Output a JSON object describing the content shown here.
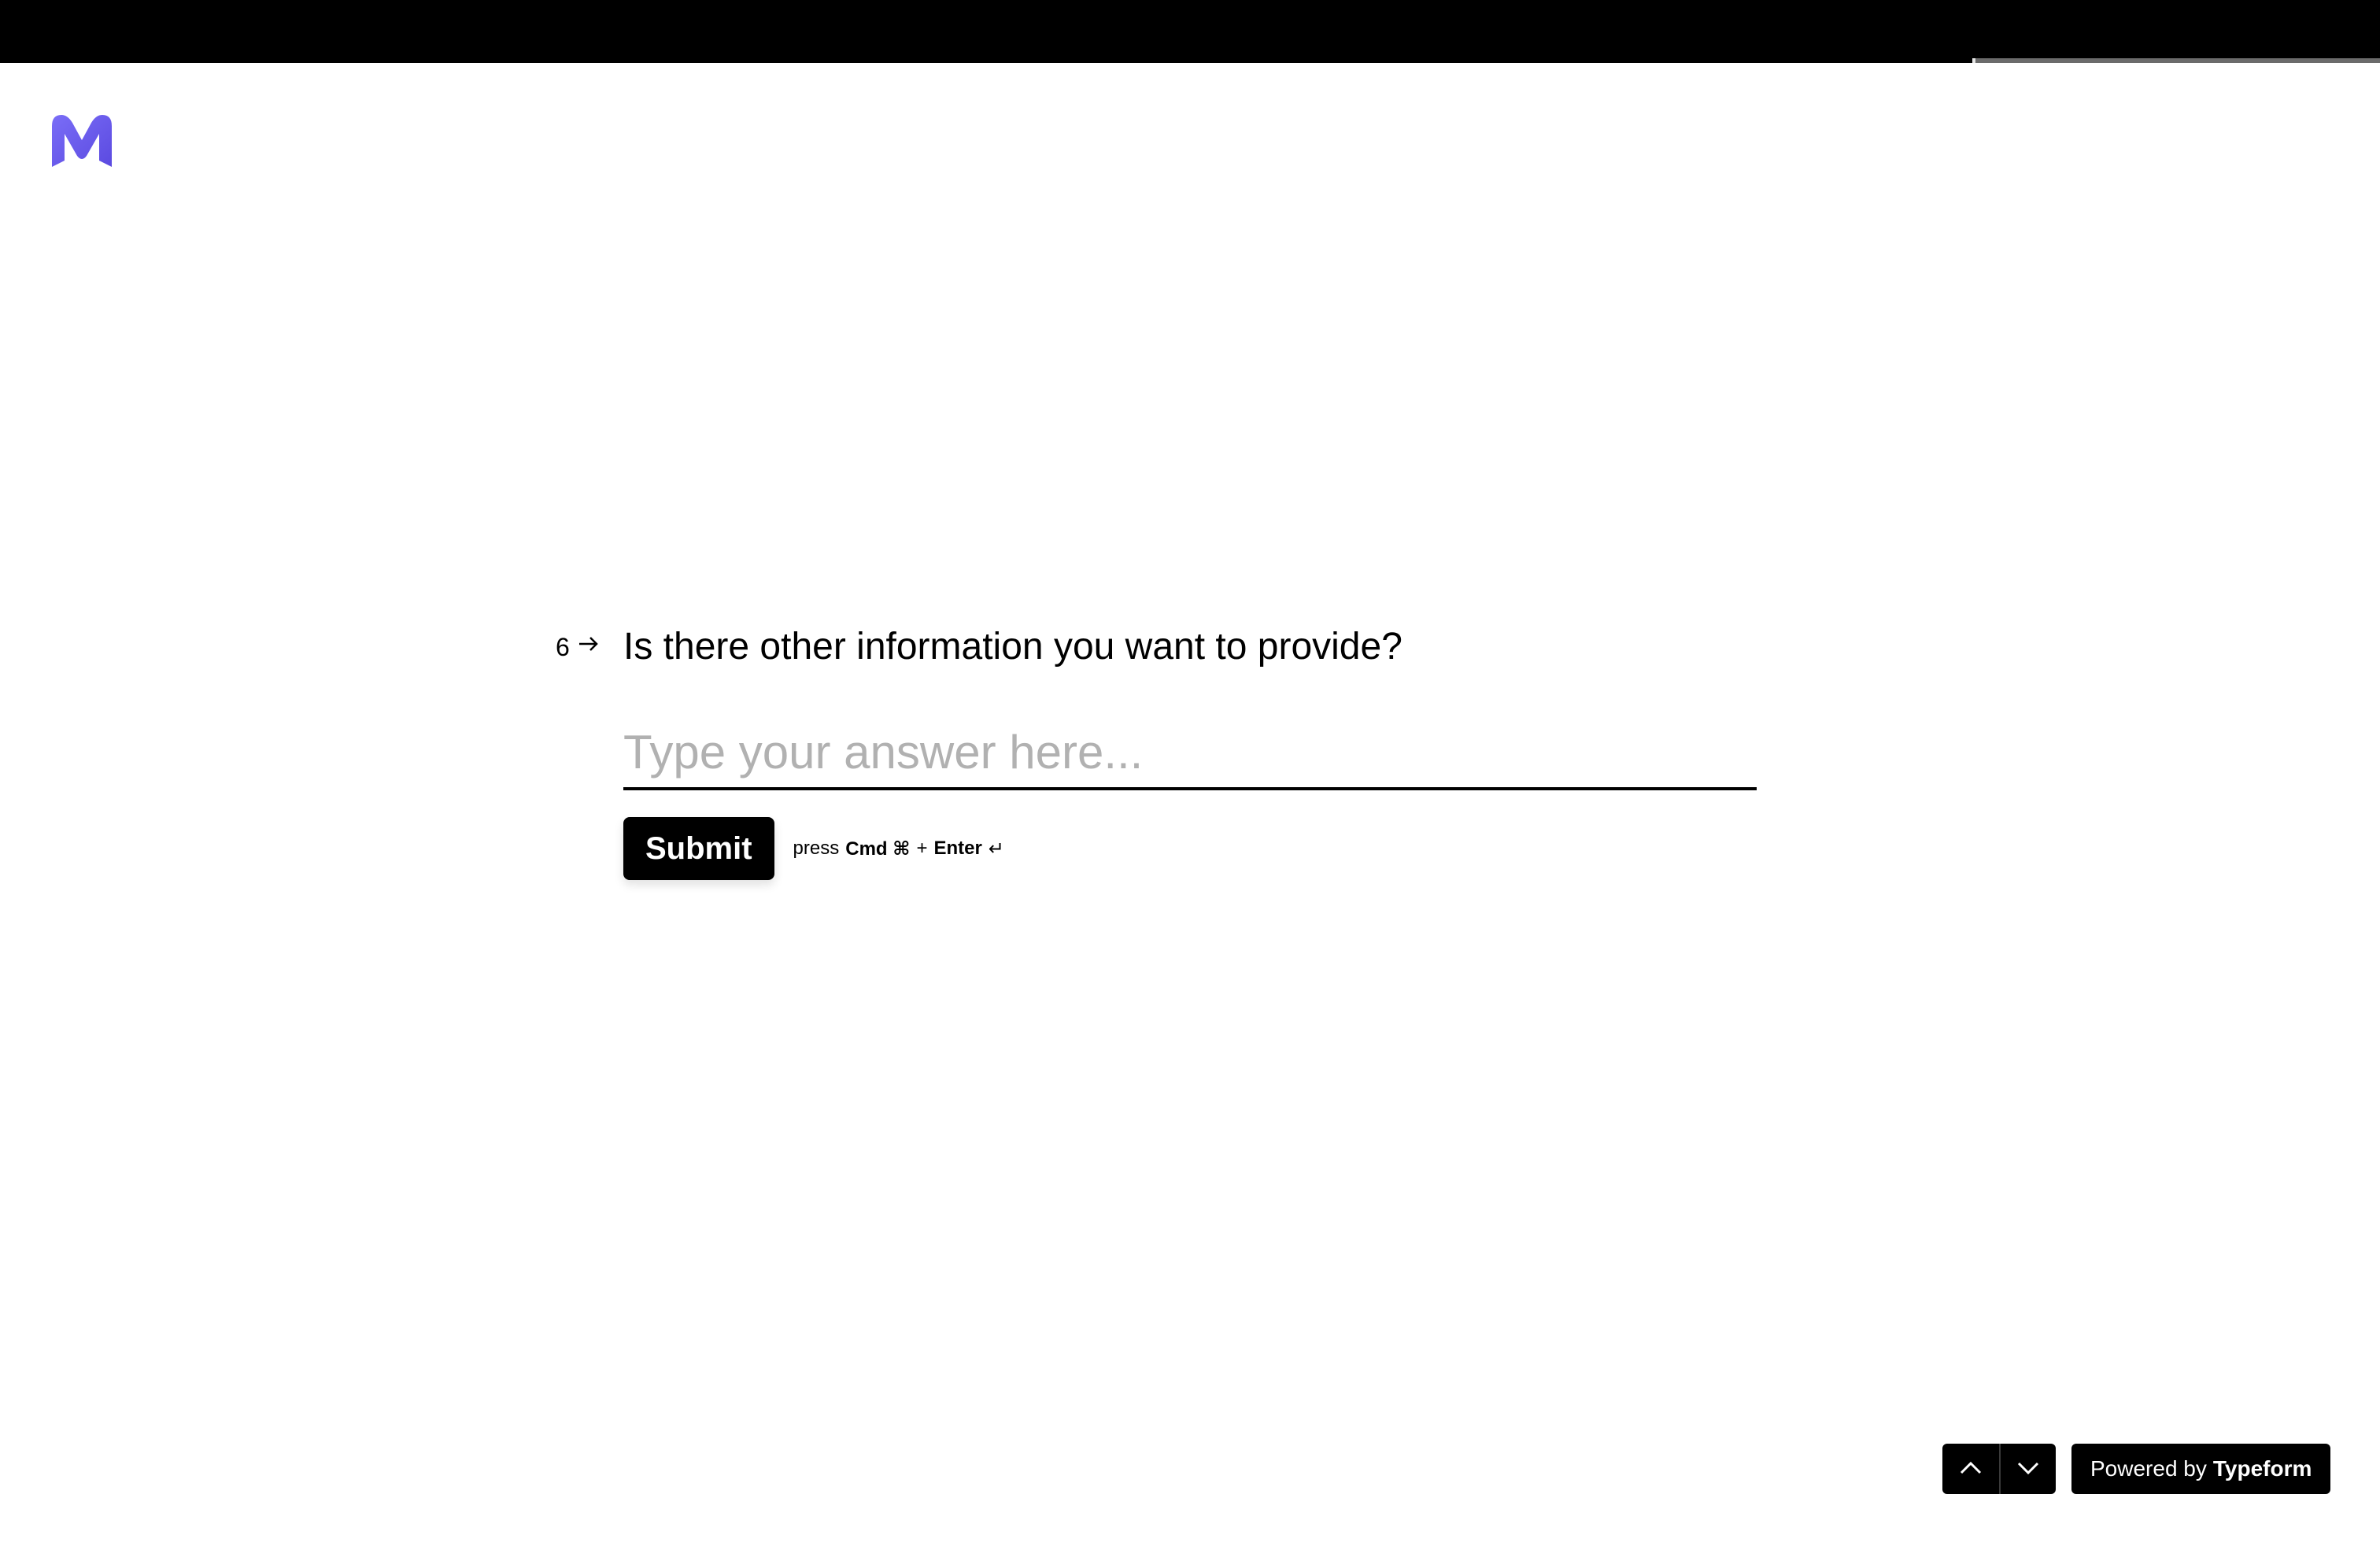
{
  "progress": {
    "fraction": 0.17
  },
  "brand": {
    "logo_icon": "m-logo-icon",
    "logo_color": "#6c63f5"
  },
  "question": {
    "number": "6",
    "arrow_icon": "arrow-right-icon",
    "text": "Is there other information you want to provide?"
  },
  "answer": {
    "placeholder": "Type your answer here...",
    "value": ""
  },
  "submit": {
    "label": "Submit",
    "hint_prefix": "press",
    "hint_key": "Cmd ⌘",
    "hint_plus": "+",
    "hint_enter": "Enter",
    "hint_enter_icon": "↵"
  },
  "footer": {
    "prev_icon": "chevron-up-icon",
    "next_icon": "chevron-down-icon",
    "powered_prefix": "Powered by",
    "powered_brand": "Typeform"
  }
}
